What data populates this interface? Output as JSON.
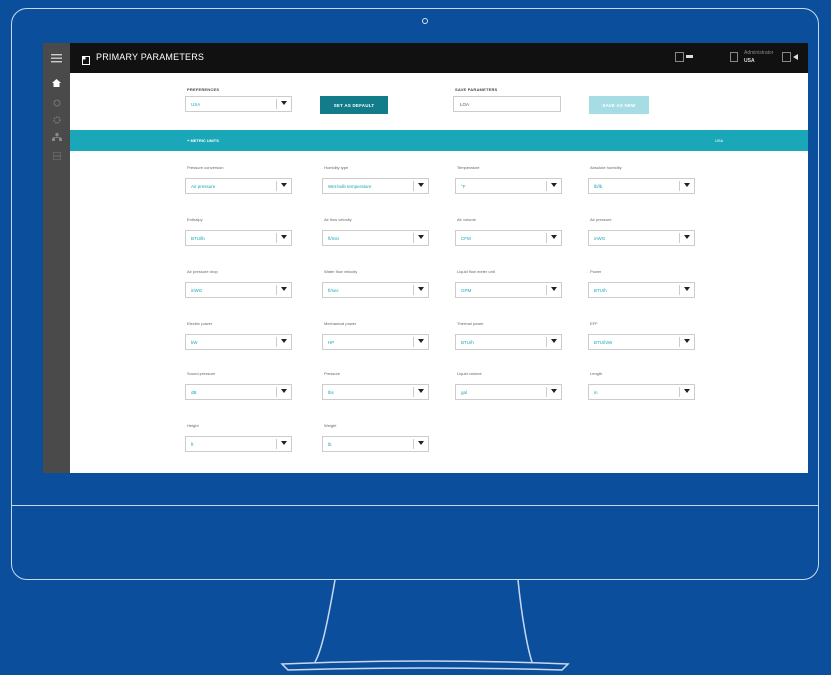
{
  "window": {
    "title": "PRIMARY PARAMETERS"
  },
  "topbar": {
    "icon_1": "list-icon",
    "user_label": "Administrator",
    "user_sub": "USA",
    "icon_2": "logout-icon"
  },
  "sidebar": {
    "items": [
      {
        "icon": "menu-icon"
      },
      {
        "icon": "home-icon"
      },
      {
        "icon": "circle-icon"
      },
      {
        "icon": "settings-icon"
      },
      {
        "icon": "network-icon"
      },
      {
        "icon": "grid-icon"
      }
    ]
  },
  "preferences": {
    "label": "PREFERENCES",
    "value": "USA",
    "set_default": "SET AS DEFAULT",
    "save_label": "SAVE PARAMETERS",
    "save_value": "LOA",
    "save_new": "SAVE AS NEW"
  },
  "section": {
    "title": "+ METRIC UNITS",
    "right": "USA"
  },
  "fields": [
    {
      "label": "Pressure conversion",
      "value": "Air pressure"
    },
    {
      "label": "Humidity type",
      "value": "Wet-bulb temperature"
    },
    {
      "label": "Temperature",
      "value": "°F"
    },
    {
      "label": "Absolute humidity",
      "value": "lb/lb"
    },
    {
      "label": "Enthalpy",
      "value": "BTU/lb"
    },
    {
      "label": "Air flow velocity",
      "value": "ft/min"
    },
    {
      "label": "Air volume",
      "value": "CFM"
    },
    {
      "label": "Air pressure",
      "value": "inWG"
    },
    {
      "label": "Air pressure drop",
      "value": "inWG"
    },
    {
      "label": "Water flow velocity",
      "value": "ft/sec"
    },
    {
      "label": "Liquid flow meter unit",
      "value": "GPM"
    },
    {
      "label": "Power",
      "value": "BTU/h"
    },
    {
      "label": "Electric power",
      "value": "kW"
    },
    {
      "label": "Mechanical power",
      "value": "HP"
    },
    {
      "label": "Thermal power",
      "value": "BTU/h"
    },
    {
      "label": "EFF",
      "value": "BTU/h/W"
    },
    {
      "label": "Sound pressure",
      "value": "dB"
    },
    {
      "label": "Pressure",
      "value": "lbs"
    },
    {
      "label": "Liquid volume",
      "value": "gal"
    },
    {
      "label": "Length",
      "value": "in"
    },
    {
      "label": "Height",
      "value": "ft"
    },
    {
      "label": "Weight",
      "value": "lb"
    }
  ],
  "colors": {
    "accent": "#1aa7b8",
    "background": "#0b4f9c",
    "topbar": "#111111",
    "sidebar": "#4a4a4a"
  }
}
